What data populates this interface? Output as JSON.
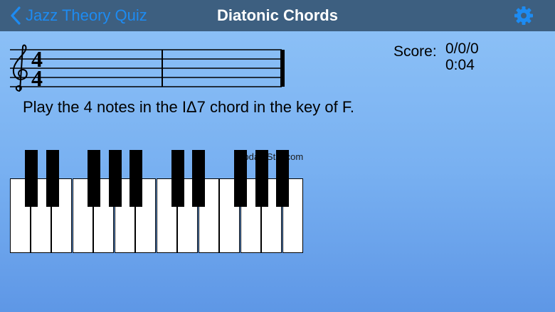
{
  "navbar": {
    "back_label": "Jazz Theory Quiz",
    "title": "Diatonic Chords",
    "settings_icon": "gear-icon"
  },
  "staff": {
    "clef": "treble-clef",
    "time_signature": {
      "top": "4",
      "bottom": "4"
    }
  },
  "score": {
    "label": "Score:",
    "value": "0/0/0",
    "time": "0:04"
  },
  "prompt": "Play the 4 notes in the IΔ7 chord in the key of F.",
  "watermark": "UpdateStar.com",
  "keyboard": {
    "white_keys": [
      "C",
      "D",
      "E",
      "F",
      "G",
      "A",
      "B",
      "C",
      "D",
      "E",
      "F",
      "G",
      "A",
      "B"
    ],
    "black_keys": [
      "C#",
      "D#",
      "F#",
      "G#",
      "A#",
      "C#",
      "D#",
      "F#",
      "G#",
      "A#"
    ]
  },
  "colors": {
    "navbar": "#3d5f80",
    "accent": "#1d8bf2",
    "background_top": "#8fc3f7",
    "background_bottom": "#5e97e6"
  }
}
